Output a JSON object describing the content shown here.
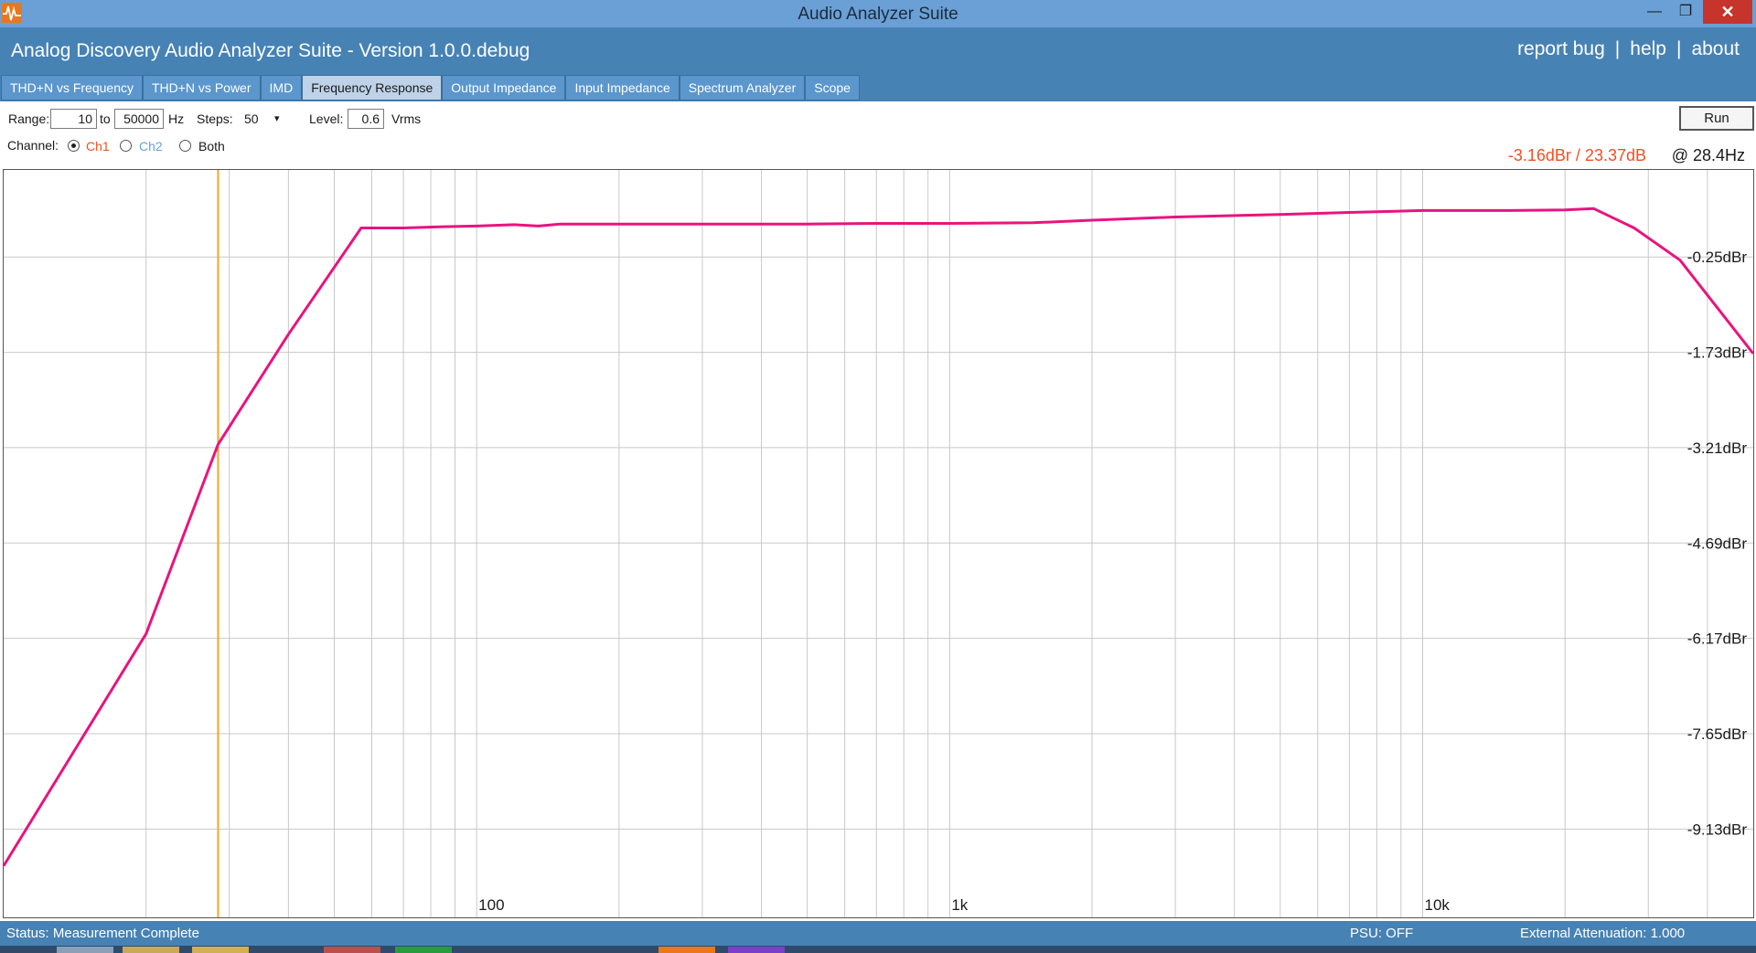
{
  "window": {
    "title": "Audio Analyzer Suite",
    "app_icon": "waveform-icon",
    "controls": {
      "minimize": "—",
      "restore": "❐",
      "close": "✕"
    }
  },
  "header": {
    "app_title": "Analog Discovery Audio Analyzer Suite - Version   1.0.0.debug",
    "links": [
      "report bug",
      "help",
      "about"
    ],
    "separator": "|"
  },
  "tabs": [
    {
      "label": "THD+N vs Frequency",
      "active": false
    },
    {
      "label": "THD+N vs Power",
      "active": false
    },
    {
      "label": "IMD",
      "active": false
    },
    {
      "label": "Frequency Response",
      "active": true
    },
    {
      "label": "Output Impedance",
      "active": false
    },
    {
      "label": "Input Impedance",
      "active": false
    },
    {
      "label": "Spectrum Analyzer",
      "active": false
    },
    {
      "label": "Scope",
      "active": false
    }
  ],
  "controls": {
    "range_label": "Range:",
    "range_from": "10",
    "to_label": "to",
    "range_to": "50000",
    "hz_label": "Hz",
    "steps_label": "Steps:",
    "steps_value": "50",
    "dropdown_arrow": "▾",
    "level_label": "Level:",
    "level_value": "0.6",
    "level_unit": "Vrms",
    "channel_label": "Channel:",
    "channels": [
      {
        "label": "Ch1",
        "checked": true,
        "color": "#f05022"
      },
      {
        "label": "Ch2",
        "checked": false,
        "color": "#6aa0d6"
      },
      {
        "label": "Both",
        "checked": false,
        "color": "#1a1a1a"
      }
    ],
    "run_label": "Run"
  },
  "readout": {
    "value": "-3.16dBr / 23.37dB",
    "freq": "@ 28.4Hz"
  },
  "chart_data": {
    "type": "line",
    "x_scale": "log",
    "xlim": [
      10,
      50000
    ],
    "ylim": [
      -10.5,
      1.1
    ],
    "x_tick_labels": [
      {
        "x": 100,
        "label": "100"
      },
      {
        "x": 1000,
        "label": "1k"
      },
      {
        "x": 10000,
        "label": "10k"
      }
    ],
    "y_tick_labels": [
      {
        "y": -0.25,
        "label": "-0.25dBr"
      },
      {
        "y": -1.73,
        "label": "-1.73dBr"
      },
      {
        "y": -3.21,
        "label": "-3.21dBr"
      },
      {
        "y": -4.69,
        "label": "-4.69dBr"
      },
      {
        "y": -6.17,
        "label": "-6.17dBr"
      },
      {
        "y": -7.65,
        "label": "-7.65dBr"
      },
      {
        "y": -9.13,
        "label": "-9.13dBr"
      }
    ],
    "grid": true,
    "cursor_x": 28.4,
    "series": [
      {
        "color": "#e8147e",
        "x": [
          10,
          20,
          28.4,
          40,
          57,
          70,
          85,
          100,
          120,
          135,
          150,
          200,
          300,
          500,
          700,
          1000,
          1500,
          2000,
          3000,
          5000,
          7000,
          10000,
          15000,
          20000,
          23000,
          28000,
          35000,
          50000
        ],
        "y": [
          -9.7,
          -6.1,
          -3.16,
          -1.45,
          0.2,
          0.2,
          0.22,
          0.23,
          0.25,
          0.23,
          0.26,
          0.26,
          0.26,
          0.26,
          0.27,
          0.27,
          0.28,
          0.32,
          0.37,
          0.41,
          0.44,
          0.47,
          0.47,
          0.48,
          0.5,
          0.2,
          -0.3,
          -1.75
        ]
      }
    ]
  },
  "status": {
    "text": "Status: Measurement Complete",
    "psu": "PSU: OFF",
    "attenuation": "External Attenuation: 1.000"
  },
  "colors": {
    "header_bg": "#4682b4",
    "titlebar_bg": "#6aa0d6",
    "trace": "#e8147e",
    "cursor": "#f5a623",
    "readout": "#f05022"
  }
}
